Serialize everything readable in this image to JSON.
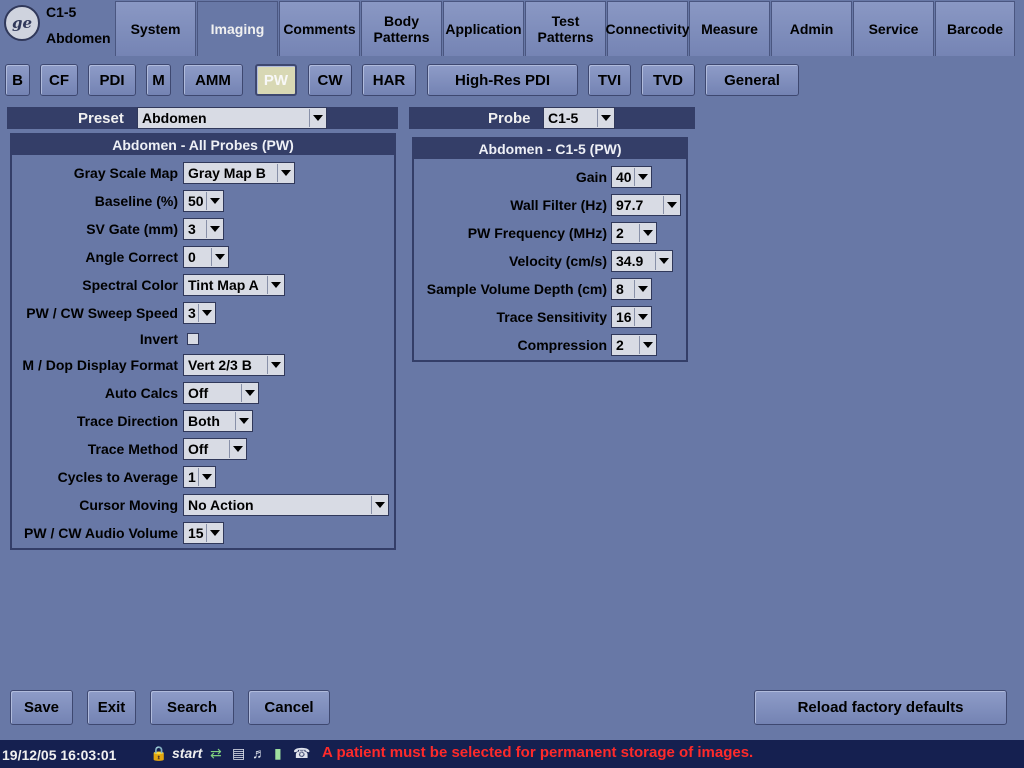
{
  "header": {
    "probe": "C1-5",
    "preset": "Abdomen",
    "tabs": [
      {
        "label": "System"
      },
      {
        "label": "Imaging"
      },
      {
        "label": "Comments"
      },
      {
        "label": "Body Patterns"
      },
      {
        "label": "Application"
      },
      {
        "label": "Test Patterns"
      },
      {
        "label": "Connectivity"
      },
      {
        "label": "Measure"
      },
      {
        "label": "Admin"
      },
      {
        "label": "Service"
      },
      {
        "label": "Barcode"
      }
    ],
    "active_tab": "Imaging"
  },
  "modes": [
    {
      "label": "B"
    },
    {
      "label": "CF"
    },
    {
      "label": "PDI"
    },
    {
      "label": "M"
    },
    {
      "label": "AMM"
    },
    {
      "label": "PW"
    },
    {
      "label": "CW"
    },
    {
      "label": "HAR"
    },
    {
      "label": "High-Res PDI"
    },
    {
      "label": "TVI"
    },
    {
      "label": "TVD"
    },
    {
      "label": "General"
    }
  ],
  "active_mode": "PW",
  "preset_select": {
    "label": "Preset",
    "value": "Abdomen"
  },
  "probe_select": {
    "label": "Probe",
    "value": "C1-5"
  },
  "left_panel": {
    "title": "Abdomen - All Probes (PW)",
    "rows": [
      {
        "label": "Gray Scale Map",
        "value": "Gray Map B"
      },
      {
        "label": "Baseline (%)",
        "value": "50"
      },
      {
        "label": "SV Gate (mm)",
        "value": "3"
      },
      {
        "label": "Angle Correct",
        "value": "0"
      },
      {
        "label": "Spectral Color",
        "value": "Tint Map A"
      },
      {
        "label": "PW / CW Sweep Speed",
        "value": "3"
      },
      {
        "label": "Invert",
        "value": ""
      },
      {
        "label": "M / Dop Display Format",
        "value": "Vert 2/3 B"
      },
      {
        "label": "Auto Calcs",
        "value": "Off"
      },
      {
        "label": "Trace Direction",
        "value": "Both"
      },
      {
        "label": "Trace Method",
        "value": "Off"
      },
      {
        "label": "Cycles to Average",
        "value": "1"
      },
      {
        "label": "Cursor Moving",
        "value": "No Action"
      },
      {
        "label": "PW / CW Audio Volume",
        "value": "15"
      }
    ],
    "invert_checked": false
  },
  "right_panel": {
    "title": "Abdomen - C1-5 (PW)",
    "rows": [
      {
        "label": "Gain",
        "value": "40"
      },
      {
        "label": "Wall Filter (Hz)",
        "value": "97.7"
      },
      {
        "label": "PW Frequency (MHz)",
        "value": "2"
      },
      {
        "label": "Velocity (cm/s)",
        "value": "34.9"
      },
      {
        "label": "Sample Volume Depth (cm)",
        "value": "8"
      },
      {
        "label": "Trace Sensitivity",
        "value": "16"
      },
      {
        "label": "Compression",
        "value": "2"
      }
    ]
  },
  "buttons": {
    "save": "Save",
    "exit": "Exit",
    "search": "Search",
    "cancel": "Cancel",
    "reload": "Reload factory defaults"
  },
  "status_bar": {
    "datetime": "19/12/05 16:03:01",
    "start": "start",
    "message": "A patient must be selected for permanent storage of images."
  },
  "colors": {
    "background": "#6878a6",
    "header_bar": "#343e68",
    "status_bar": "#152050",
    "status_message": "#ff2a2a"
  },
  "icons": [
    "ge-logo",
    "lock-icon",
    "network-icon",
    "printer-icon",
    "audio-icon",
    "battery-icon",
    "phone-icon"
  ]
}
